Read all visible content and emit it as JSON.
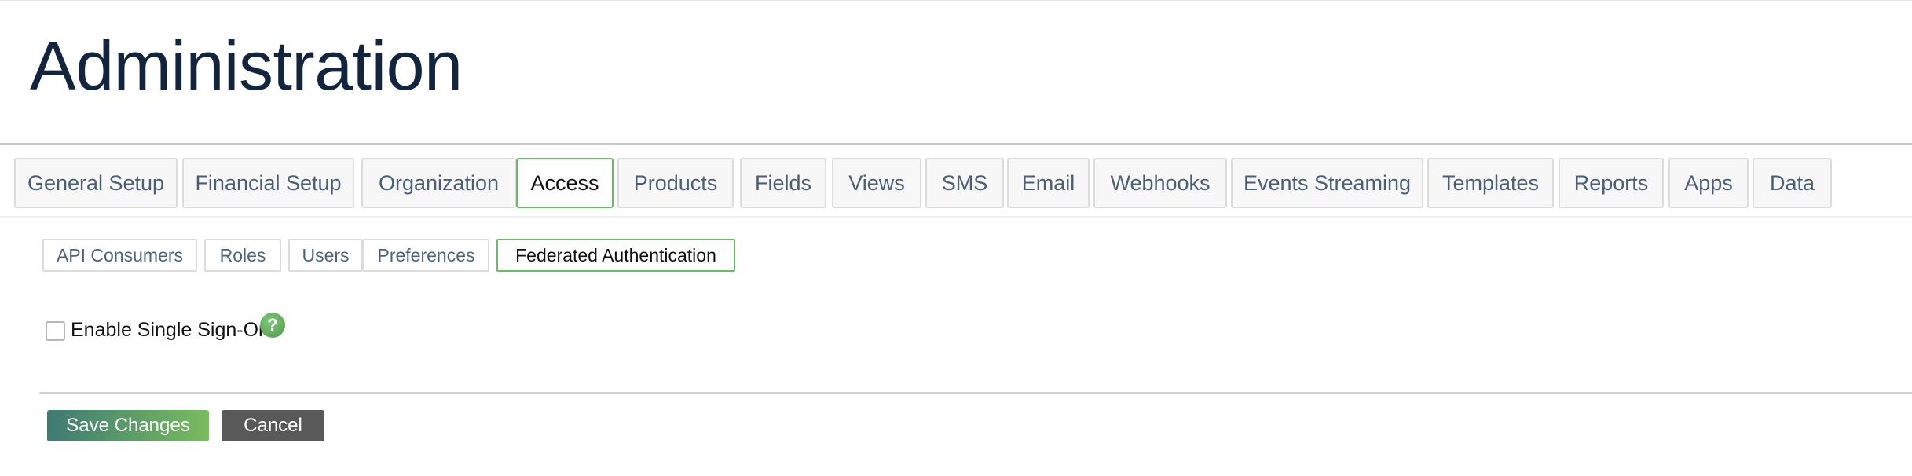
{
  "page": {
    "title": "Administration"
  },
  "main_tabs": [
    {
      "label": "General Setup"
    },
    {
      "label": "Financial Setup"
    },
    {
      "label": "Organization"
    },
    {
      "label": "Access",
      "active": true
    },
    {
      "label": "Products"
    },
    {
      "label": "Fields"
    },
    {
      "label": "Views"
    },
    {
      "label": "SMS"
    },
    {
      "label": "Email"
    },
    {
      "label": "Webhooks"
    },
    {
      "label": "Events Streaming"
    },
    {
      "label": "Templates"
    },
    {
      "label": "Reports"
    },
    {
      "label": "Apps"
    },
    {
      "label": "Data"
    }
  ],
  "sub_tabs": [
    {
      "label": "API Consumers"
    },
    {
      "label": "Roles"
    },
    {
      "label": "Users"
    },
    {
      "label": "Preferences"
    },
    {
      "label": "Federated Authentication",
      "active": true
    }
  ],
  "sso": {
    "label": "Enable Single Sign-On",
    "checked": false,
    "help_icon": "question-mark-icon",
    "help_symbol": "?"
  },
  "actions": {
    "save_label": "Save Changes",
    "cancel_label": "Cancel"
  },
  "colors": {
    "accent_green": "#6db86b",
    "title_navy": "#13253e",
    "save_gradient_start": "#3e7a73",
    "save_gradient_end": "#79bc5e",
    "cancel_gray": "#595959"
  }
}
